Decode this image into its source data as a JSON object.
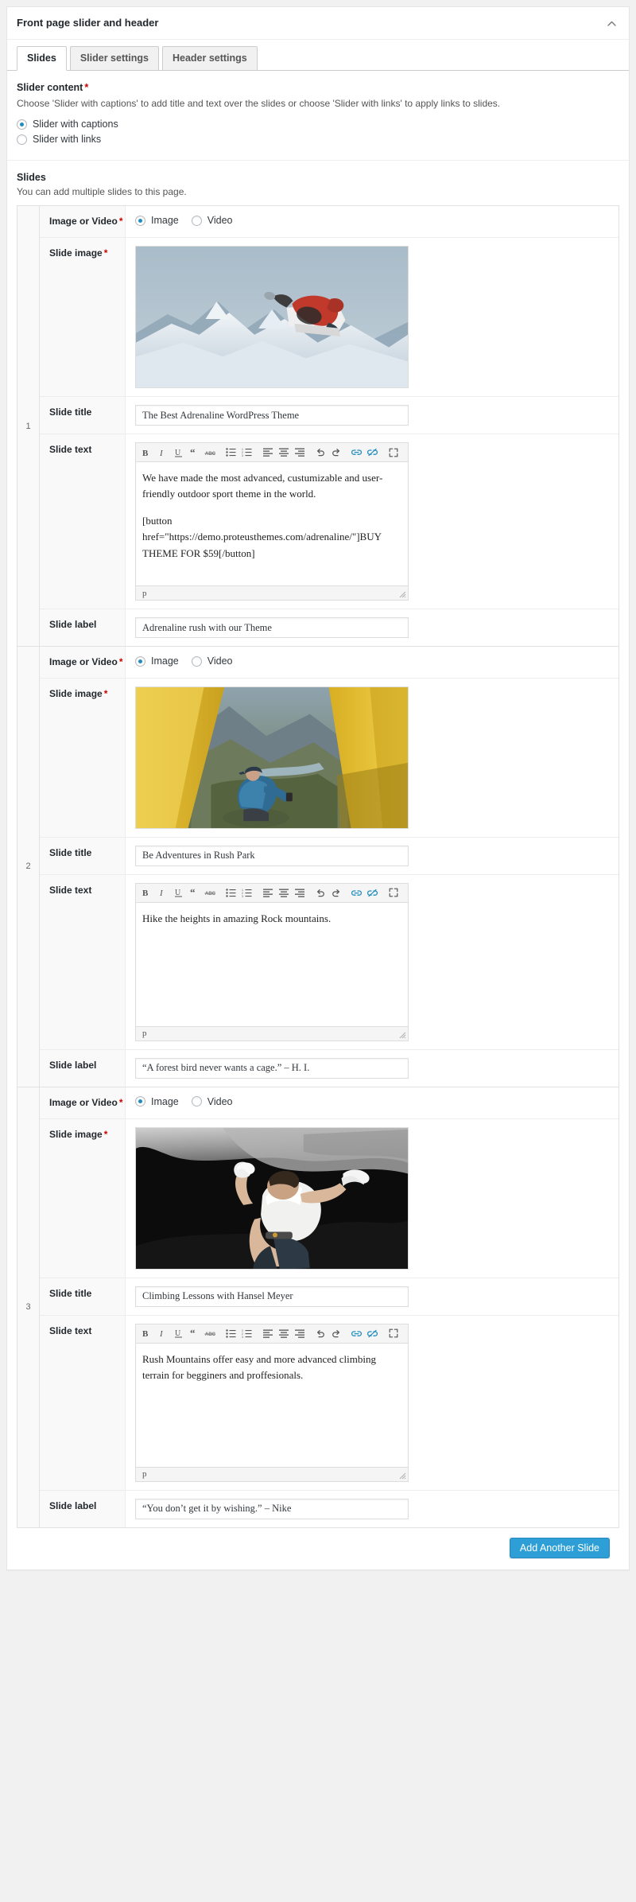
{
  "metabox": {
    "title": "Front page slider and header",
    "toggle_icon": "chevron-up-icon"
  },
  "tabs": [
    {
      "label": "Slides",
      "active": true
    },
    {
      "label": "Slider settings",
      "active": false
    },
    {
      "label": "Header settings",
      "active": false
    }
  ],
  "slider_content": {
    "label": "Slider content",
    "required_marker": "*",
    "description": "Choose 'Slider with captions' to add title and text over the slides or choose 'Slider with links' to apply links to slides.",
    "options": [
      {
        "label": "Slider with captions",
        "checked": true
      },
      {
        "label": "Slider with links",
        "checked": false
      }
    ]
  },
  "slides_section": {
    "title": "Slides",
    "description": "You can add multiple slides to this page.",
    "add_button": "Add Another Slide"
  },
  "field_labels": {
    "image_or_video": "Image or Video",
    "slide_image": "Slide image",
    "slide_title": "Slide title",
    "slide_text": "Slide text",
    "slide_label": "Slide label",
    "required_marker": "*",
    "radio_image": "Image",
    "radio_video": "Video",
    "editor_path": "p"
  },
  "editor_toolbar": [
    {
      "name": "bold-icon",
      "glyph": "B"
    },
    {
      "name": "italic-icon",
      "glyph": "I"
    },
    {
      "name": "underline-icon",
      "glyph": "U"
    },
    {
      "name": "blockquote-icon",
      "glyph": "“"
    },
    {
      "name": "strikethrough-icon",
      "glyph": "ABC"
    },
    {
      "name": "bulleted-list-icon",
      "glyph": ""
    },
    {
      "name": "numbered-list-icon",
      "glyph": ""
    },
    {
      "name": "align-left-icon",
      "glyph": ""
    },
    {
      "name": "align-center-icon",
      "glyph": ""
    },
    {
      "name": "align-right-icon",
      "glyph": ""
    },
    {
      "name": "undo-icon",
      "glyph": ""
    },
    {
      "name": "redo-icon",
      "glyph": ""
    },
    {
      "name": "insert-link-icon",
      "glyph": ""
    },
    {
      "name": "remove-link-icon",
      "glyph": ""
    },
    {
      "name": "fullscreen-icon",
      "glyph": ""
    }
  ],
  "slides": [
    {
      "index": "1",
      "media_type_image_checked": true,
      "media_type_video_checked": false,
      "image_alt": "Snowboarder jumping over snowy mountains",
      "title": "The Best Adrenaline WordPress Theme",
      "text_paragraphs": [
        "We have made the most advanced, custumizable and user-friendly outdoor sport theme in the world.",
        "[button href=\"https://demo.proteusthemes.com/adrenaline/\"]BUY THEME FOR $59[/button]"
      ],
      "label": "Adrenaline rush with our Theme"
    },
    {
      "index": "2",
      "media_type_image_checked": true,
      "media_type_video_checked": false,
      "image_alt": "Woman sitting in a yellow tent looking at a mountain valley",
      "title": "Be Adventures in Rush Park",
      "text_paragraphs": [
        "Hike the heights in amazing Rock mountains."
      ],
      "label": "“A forest bird never wants a cage.” – H. I."
    },
    {
      "index": "3",
      "media_type_image_checked": true,
      "media_type_video_checked": false,
      "image_alt": "Rock climber on an overhanging cliff, black and white",
      "title": "Climbing Lessons with Hansel Meyer",
      "text_paragraphs": [
        "Rush Mountains offer easy and more advanced climbing terrain for begginers and proffesionals."
      ],
      "label": "“You don’t get it by wishing.” – Nike"
    }
  ],
  "colors": {
    "accent": "#1e8cbe",
    "primary_button": "#2e9fd6",
    "required": "#cc0000",
    "panel_border": "#e5e5e5"
  }
}
